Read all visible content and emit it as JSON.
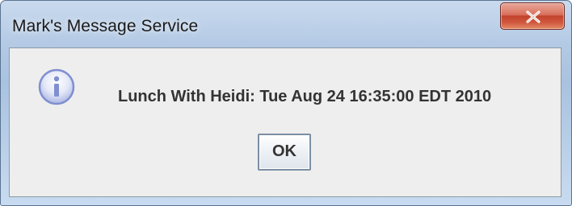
{
  "window": {
    "title": "Mark's Message Service"
  },
  "dialog": {
    "icon": "info-icon",
    "message": "Lunch With Heidi: Tue Aug 24 16:35:00 EDT 2010",
    "ok_label": "OK"
  },
  "colors": {
    "titlebar": "#b3c9e4",
    "close_button": "#c2432c",
    "client_background": "#eeeeee",
    "icon_accent": "#7f8fd0"
  }
}
